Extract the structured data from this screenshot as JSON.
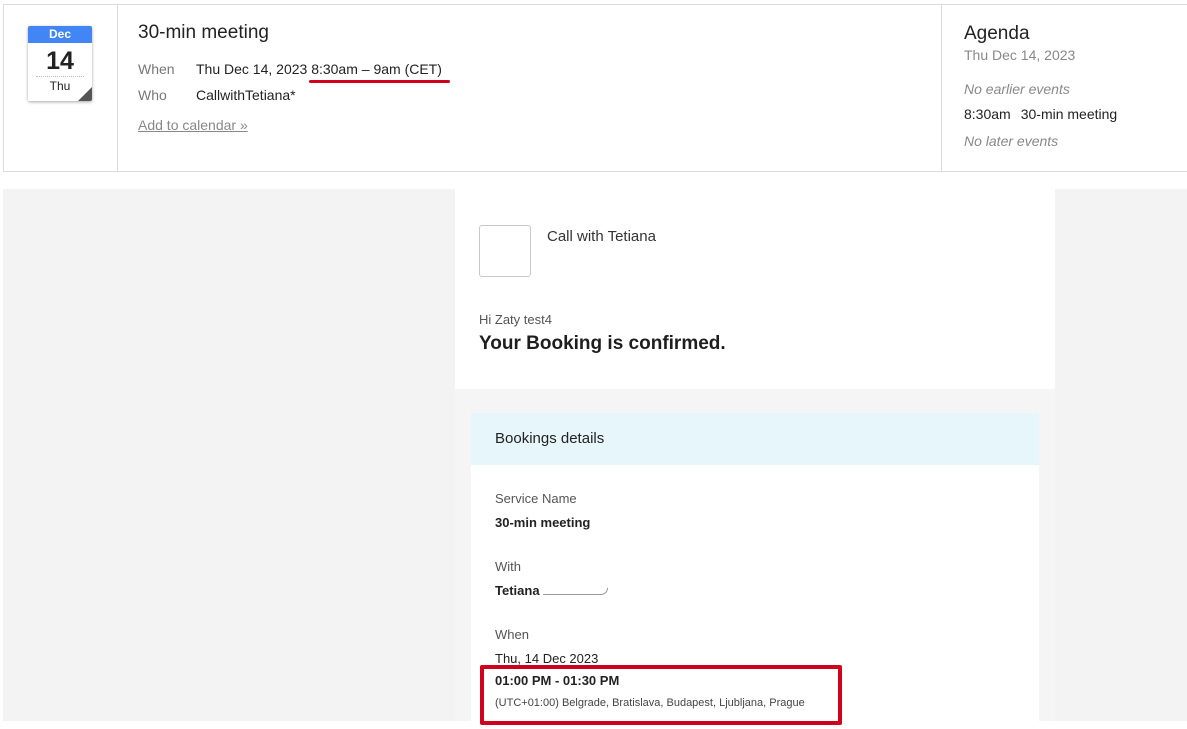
{
  "invite": {
    "calendar_icon": {
      "month": "Dec",
      "day": "14",
      "weekday": "Thu"
    },
    "event_title": "30-min meeting",
    "when_label": "When",
    "when_date": "Thu Dec 14, 2023",
    "when_time": "8:30am – 9am (CET)",
    "who_label": "Who",
    "who_value": "CallwithTetiana*",
    "add_to_calendar": "Add to calendar »",
    "annotation_color": "#d0021b"
  },
  "agenda": {
    "title": "Agenda",
    "date": "Thu Dec 14, 2023",
    "no_earlier": "No earlier events",
    "event_time": "8:30am",
    "event_title": "30-min meeting",
    "no_later": "No later events"
  },
  "email": {
    "brand": "Call with Tetiana",
    "greeting": "Hi Zaty test4",
    "confirmation": "Your Booking is confirmed.",
    "details_header": "Bookings details",
    "service_label": "Service Name",
    "service_value": "30-min meeting",
    "with_label": "With",
    "with_value": "Tetiana",
    "when_label": "When",
    "when_date": "Thu, 14 Dec 2023",
    "when_time": "01:00 PM - 01:30 PM",
    "timezone": "(UTC+01:00) Belgrade, Bratislava, Budapest, Ljubljana, Prague",
    "header_bg": "#e7f6fb"
  }
}
